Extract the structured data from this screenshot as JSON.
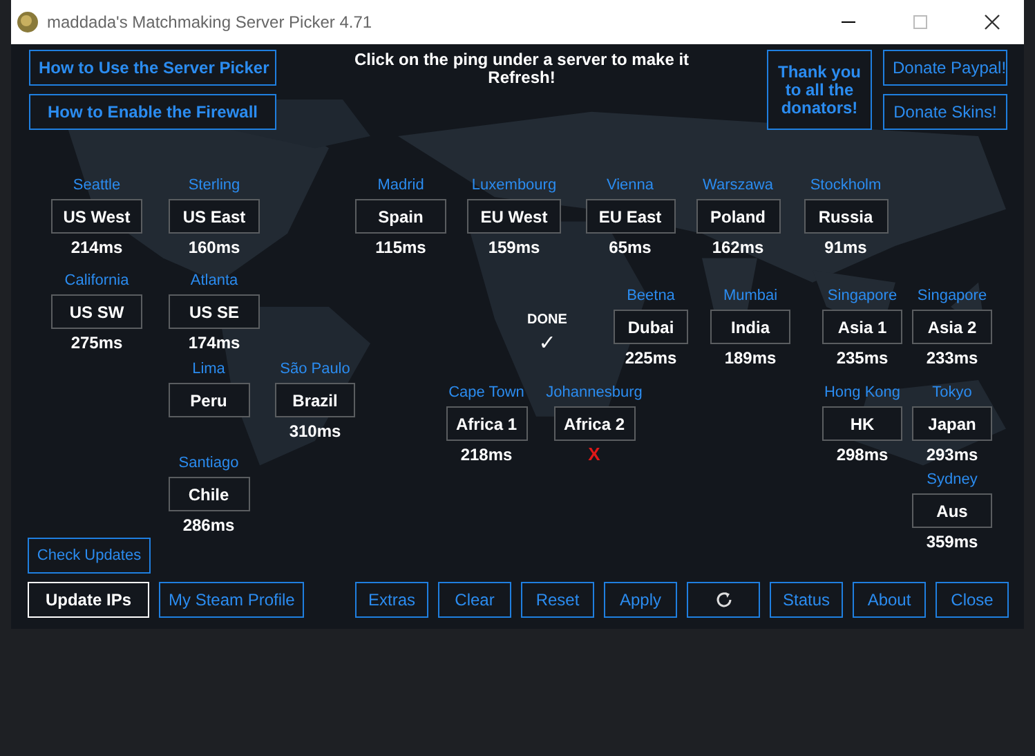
{
  "window": {
    "title": "maddada's Matchmaking Server Picker 4.71"
  },
  "header": {
    "left_buttons": [
      "How to Use the Server Picker",
      "How to Enable the Firewall"
    ],
    "instruction": "Click on the ping under a server to make it Refresh!",
    "thanks": "Thank you to all the donators!",
    "right_buttons": [
      "Donate Paypal!",
      "Donate Skins!"
    ]
  },
  "servers": [
    {
      "city": "Seattle",
      "name": "US West",
      "result": {
        "kind": "ping",
        "text": "214ms"
      }
    },
    {
      "city": "Sterling",
      "name": "US East",
      "result": {
        "kind": "ping",
        "text": "160ms"
      }
    },
    {
      "city": "Madrid",
      "name": "Spain",
      "result": {
        "kind": "ping",
        "text": "115ms"
      }
    },
    {
      "city": "Luxembourg",
      "name": "EU West",
      "result": {
        "kind": "ping",
        "text": "159ms"
      }
    },
    {
      "city": "Vienna",
      "name": "EU East",
      "result": {
        "kind": "ping",
        "text": "65ms"
      }
    },
    {
      "city": "Warszawa",
      "name": "Poland",
      "result": {
        "kind": "ping",
        "text": "162ms"
      }
    },
    {
      "city": "Stockholm",
      "name": "Russia",
      "result": {
        "kind": "ping",
        "text": "91ms"
      }
    },
    {
      "city": "California",
      "name": "US SW",
      "result": {
        "kind": "ping",
        "text": "275ms"
      }
    },
    {
      "city": "Atlanta",
      "name": "US SE",
      "result": {
        "kind": "ping",
        "text": "174ms"
      }
    },
    {
      "city": "Beetna",
      "name": "Dubai",
      "result": {
        "kind": "ping",
        "text": "225ms"
      }
    },
    {
      "city": "Mumbai",
      "name": "India",
      "result": {
        "kind": "ping",
        "text": "189ms"
      }
    },
    {
      "city": "Singapore",
      "name": "Asia 1",
      "result": {
        "kind": "ping",
        "text": "235ms"
      }
    },
    {
      "city": "Singapore",
      "name": "Asia 2",
      "result": {
        "kind": "ping",
        "text": "233ms"
      }
    },
    {
      "city": "Lima",
      "name": "Peru"
    },
    {
      "city": "São Paulo",
      "name": "Brazil",
      "result": {
        "kind": "ping",
        "text": "310ms"
      }
    },
    {
      "city": "Cape Town",
      "name": "Africa 1",
      "result": {
        "kind": "ping",
        "text": "218ms"
      }
    },
    {
      "city": "Johannesburg",
      "name": "Africa 2",
      "result": {
        "kind": "failed",
        "text": "X"
      }
    },
    {
      "city": "Hong Kong",
      "name": "HK",
      "result": {
        "kind": "ping",
        "text": "298ms"
      }
    },
    {
      "city": "Tokyo",
      "name": "Japan",
      "result": {
        "kind": "ping",
        "text": "293ms"
      }
    },
    {
      "city": "Santiago",
      "name": "Chile",
      "result": {
        "kind": "ping",
        "text": "286ms"
      }
    },
    {
      "city": "Sydney",
      "name": "Aus",
      "result": {
        "kind": "ping",
        "text": "359ms"
      }
    }
  ],
  "status": {
    "text": "DONE",
    "mark": "✓"
  },
  "footer": {
    "check_updates": "Check Updates",
    "left_buttons": [
      {
        "label": "Update IPs",
        "focused": true
      },
      {
        "label": "My Steam Profile",
        "focused": false
      }
    ],
    "right_buttons": [
      {
        "kind": "text",
        "label": "Extras"
      },
      {
        "kind": "text",
        "label": "Clear"
      },
      {
        "kind": "text",
        "label": "Reset"
      },
      {
        "kind": "text",
        "label": "Apply"
      },
      {
        "kind": "refresh"
      },
      {
        "kind": "text",
        "label": "Status"
      },
      {
        "kind": "text",
        "label": "About"
      },
      {
        "kind": "text",
        "label": "Close"
      }
    ]
  }
}
